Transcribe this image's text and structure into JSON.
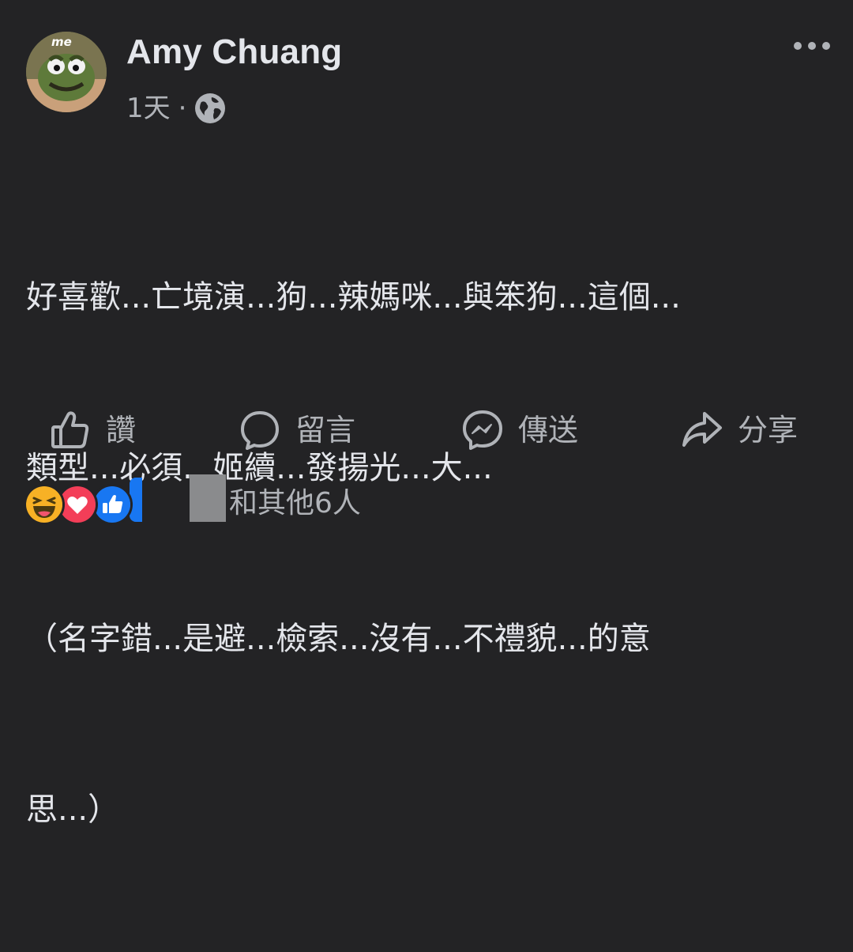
{
  "post": {
    "author": "Amy Chuang",
    "avatar_badge": "me",
    "timestamp": "1天",
    "separator": "·",
    "audience_icon": "globe-icon",
    "text_lines": [
      "好喜歡...亡境演...狗...辣媽咪...與笨狗...這個...",
      "類型...必須...姬續...發揚光...大...",
      "（名字錯...是避...檢索...沒有...不禮貌...的意",
      "思...）"
    ]
  },
  "actions": {
    "like": "讚",
    "comment": "留言",
    "send": "傳送",
    "share": "分享"
  },
  "reactions": {
    "icons": [
      "haha-icon",
      "love-icon",
      "like-icon"
    ],
    "summary": "和其他6人"
  },
  "colors": {
    "background": "#232325",
    "text_primary": "#e4e6eb",
    "text_secondary": "#b0b3b8",
    "like_blue": "#1877f2",
    "love_red": "#f33e58",
    "haha_yellow": "#f7b125"
  }
}
